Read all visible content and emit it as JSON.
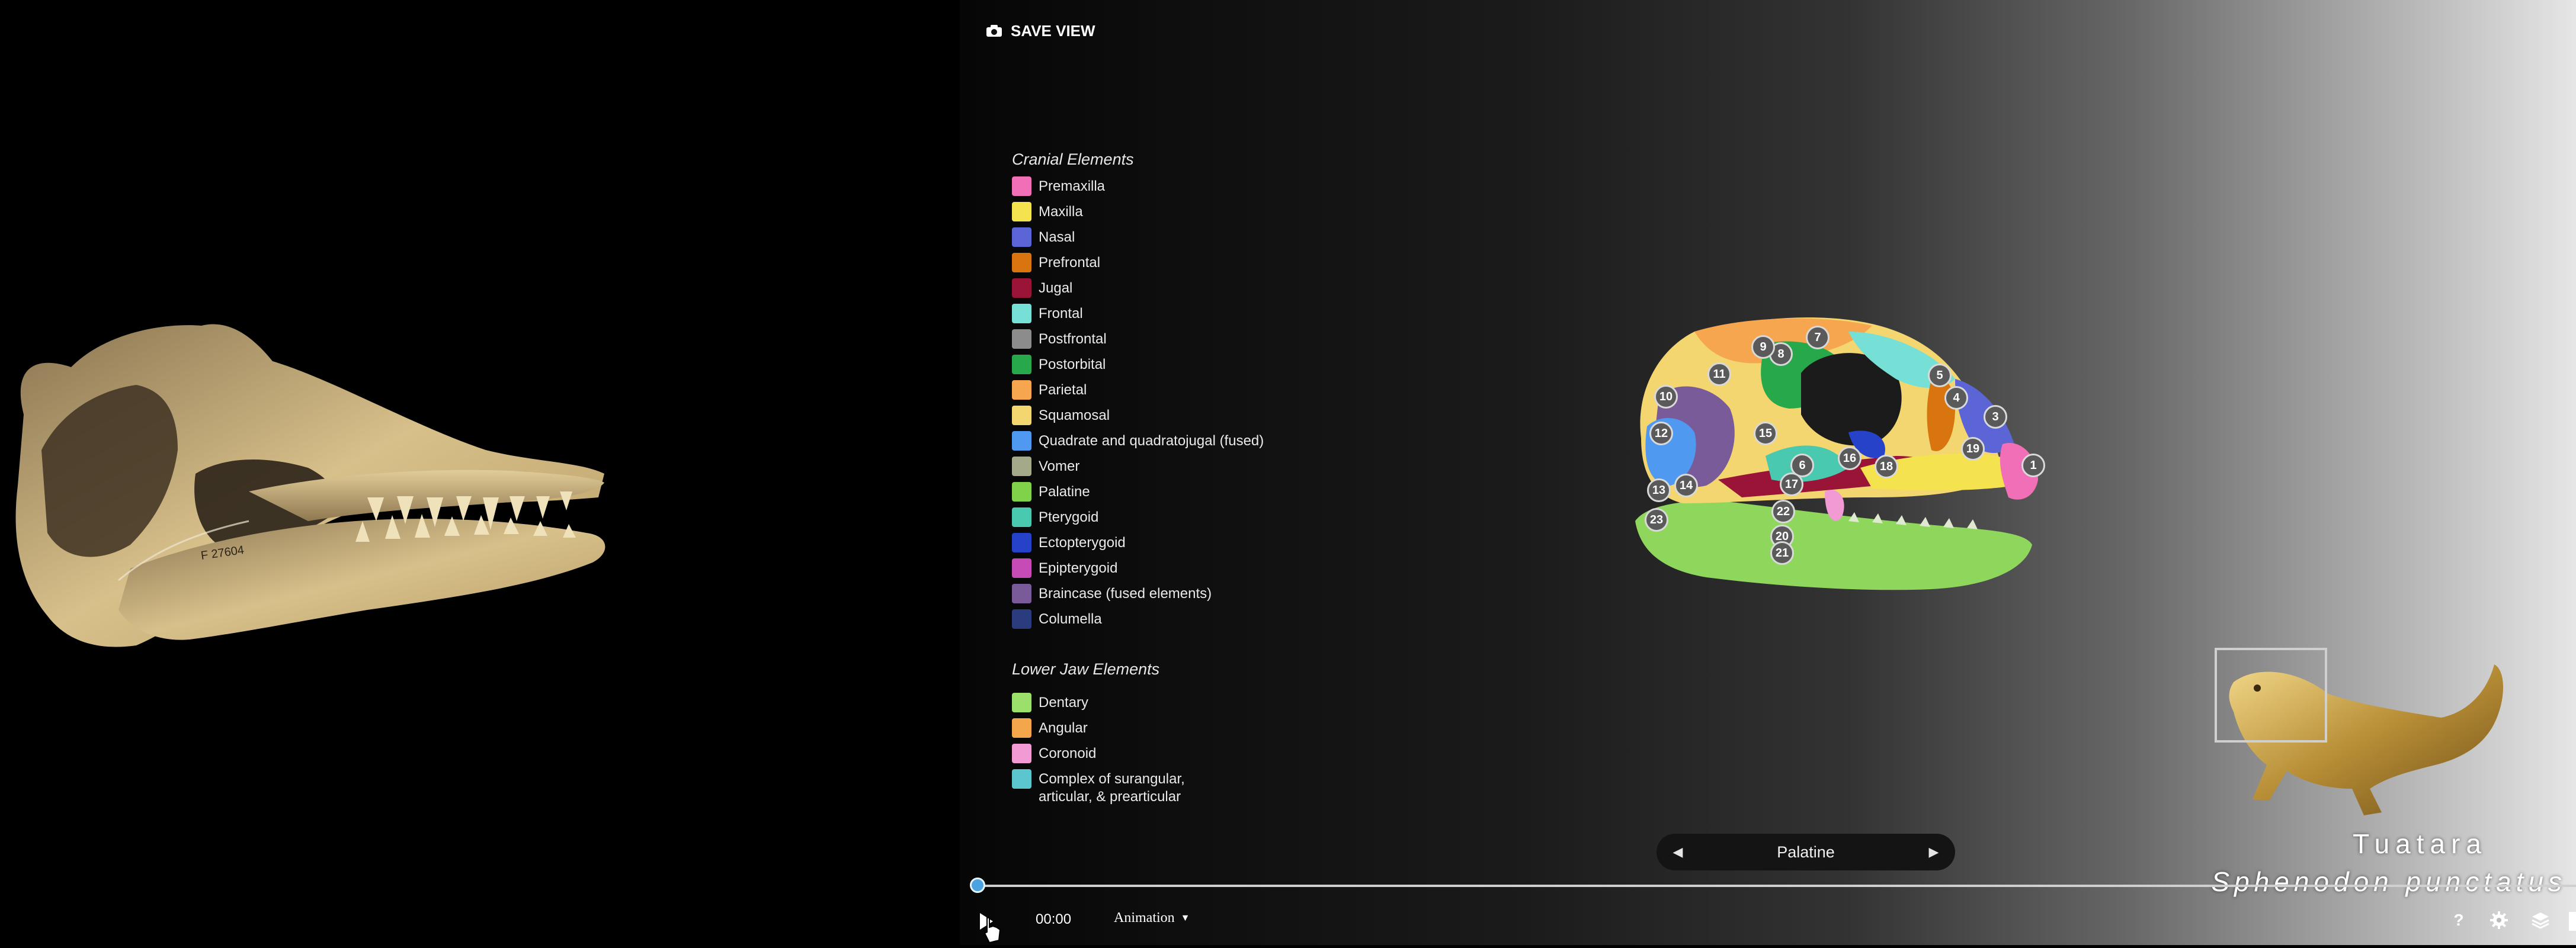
{
  "toolbar": {
    "save_view_label": "SAVE VIEW",
    "save_icon": "camera-icon"
  },
  "legend": {
    "cranial_heading": "Cranial Elements",
    "cranial": [
      {
        "label": "Premaxilla",
        "color": "#f06fb6"
      },
      {
        "label": "Maxilla",
        "color": "#f4e24e"
      },
      {
        "label": "Nasal",
        "color": "#5b65d6"
      },
      {
        "label": "Prefrontal",
        "color": "#d9750f"
      },
      {
        "label": "Jugal",
        "color": "#9a1437"
      },
      {
        "label": "Frontal",
        "color": "#76e0d6"
      },
      {
        "label": "Postfrontal",
        "color": "#8c8c8c"
      },
      {
        "label": "Postorbital",
        "color": "#27a84a"
      },
      {
        "label": "Parietal",
        "color": "#f5a64f"
      },
      {
        "label": "Squamosal",
        "color": "#f3d66f"
      },
      {
        "label": "Quadrate and quadratojugal (fused)",
        "color": "#4f9af0"
      },
      {
        "label": "Vomer",
        "color": "#a4a98a"
      },
      {
        "label": "Palatine",
        "color": "#7fd24a"
      },
      {
        "label": "Pterygoid",
        "color": "#49c9b0"
      },
      {
        "label": "Ectopterygoid",
        "color": "#2542c8"
      },
      {
        "label": "Epipterygoid",
        "color": "#c64bb7"
      },
      {
        "label": "Braincase (fused elements)",
        "color": "#7a5b9a"
      },
      {
        "label": "Columella",
        "color": "#2a3c7e"
      }
    ],
    "jaw_heading": "Lower Jaw Elements",
    "jaw": [
      {
        "label": "Dentary",
        "color": "#9be06a"
      },
      {
        "label": "Angular",
        "color": "#f4a64a"
      },
      {
        "label": "Coronoid",
        "color": "#f29ad4"
      },
      {
        "label_line1": "Complex of surangular,",
        "label_line2": "articular, & prearticular",
        "color": "#5cc6cf"
      }
    ]
  },
  "skull_labels": [
    "1",
    "3",
    "4",
    "5",
    "6",
    "7",
    "8",
    "9",
    "10",
    "11",
    "12",
    "13",
    "14",
    "15",
    "16",
    "17",
    "18",
    "19",
    "20",
    "21",
    "22",
    "23"
  ],
  "element_nav": {
    "prev_icon": "chevron-left-icon",
    "current": "Palatine",
    "next_icon": "chevron-right-icon"
  },
  "playback": {
    "play_icon": "play-icon",
    "time": "00:00",
    "mode": "Animation",
    "progress": 0
  },
  "specimen": {
    "common_name": "Tuatara",
    "scientific_name": "Sphenodon punctatus"
  },
  "footer_icons": [
    "help-icon",
    "gear-icon",
    "layers-icon"
  ]
}
